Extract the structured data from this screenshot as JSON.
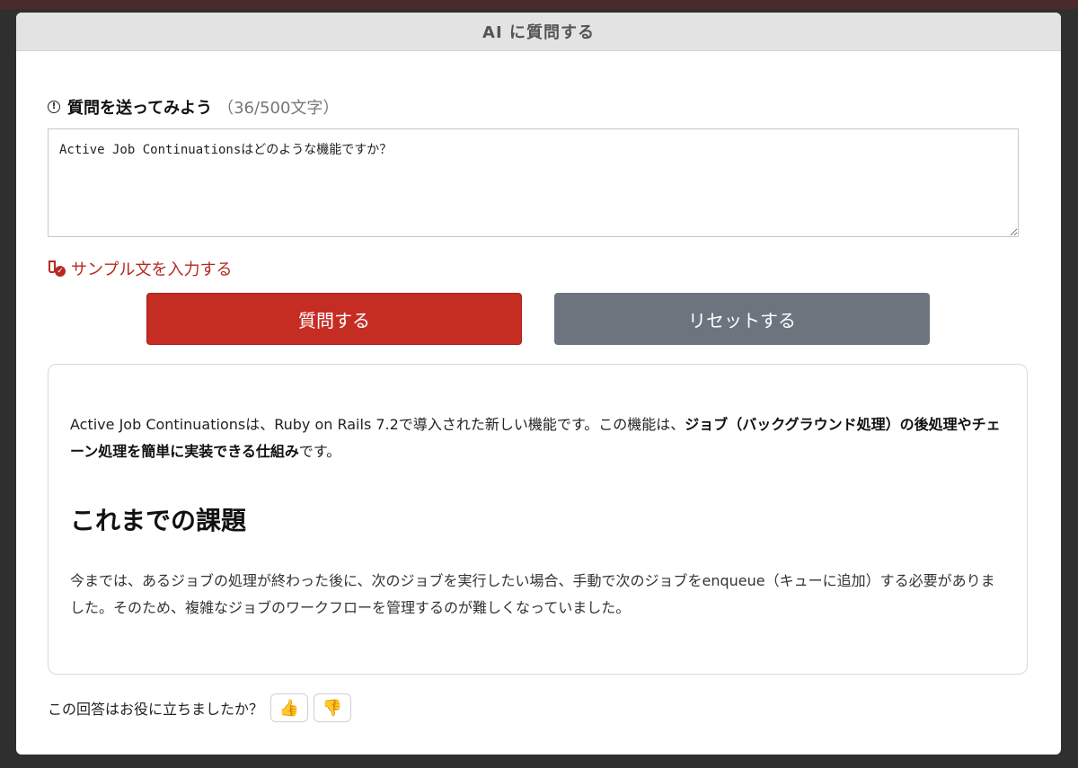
{
  "modal": {
    "title": "AI に質問する"
  },
  "question": {
    "label": "質問を送ってみよう",
    "char_count": "（36/500文字）",
    "value": "Active Job Continuationsはどのような機能ですか？"
  },
  "sample_link": "サンプル文を入力する",
  "buttons": {
    "submit": "質問する",
    "reset": "リセットする"
  },
  "answer": {
    "p1_plain_before": "Active Job Continuationsは、Ruby on Rails 7.2で導入された新しい機能です。この機能は、",
    "p1_bold": "ジョブ（バックグラウンド処理）の後処理やチェーン処理を簡単に実装できる仕組み",
    "p1_plain_after": "です。",
    "heading": "これまでの課題",
    "p2": "今までは、あるジョブの処理が終わった後に、次のジョブを実行したい場合、手動で次のジョブをenqueue（キューに追加）する必要がありました。そのため、複雑なジョブのワークフローを管理するのが難しくなっていました。"
  },
  "feedback": {
    "question": "この回答はお役に立ちましたか？",
    "thumbs_up_icon": "thumbs-up-icon",
    "thumbs_down_icon": "thumbs-down-icon"
  },
  "colors": {
    "accent": "#c52d23",
    "secondary": "#6c757d"
  }
}
